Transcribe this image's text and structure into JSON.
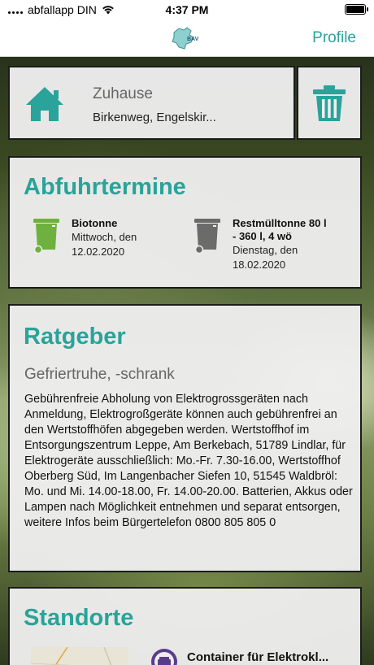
{
  "status_bar": {
    "carrier": "abfallapp DIN",
    "time": "4:37 PM"
  },
  "nav": {
    "logo_text": "BAV",
    "profile_label": "Profile"
  },
  "home": {
    "title": "Zuhause",
    "address": "Birkenweg, Engelskir..."
  },
  "abfuhrtermine": {
    "title": "Abfuhrtermine",
    "bins": [
      {
        "name": "Biotonne",
        "day": "Mittwoch, den",
        "date": "12.02.2020",
        "color": "#6fb13f",
        "icon": "green-bin-icon"
      },
      {
        "name_line1": "Restmülltonne 80 l",
        "name_line2": "- 360 l, 4 wö",
        "day": "Dienstag, den",
        "date": "18.02.2020",
        "color": "#6b6b6b",
        "icon": "gray-bin-icon"
      }
    ]
  },
  "ratgeber": {
    "title": "Ratgeber",
    "subtitle": "Gefriertruhe, -schrank",
    "text": "Gebührenfreie Abholung von Elektrogrossgeräten nach Anmeldung, Elektrogroßgeräte können auch gebührenfrei an den Wertstoffhöfen abgegeben werden. Wertstoffhof im Entsorgungszentrum Leppe, Am Berkebach, 51789 Lindlar, für Elektrogeräte ausschließlich: Mo.-Fr. 7.30-16.00, Wertstoffhof Oberberg Süd, Im Langenbacher Siefen 10, 51545 Waldbröl: Mo. und Mi. 14.00-18.00, Fr. 14.00-20.00. Batterien, Akkus oder Lampen nach Möglichkeit entnehmen und separat entsorgen, weitere Infos beim Bürgertelefon 0800 805 805 0"
  },
  "standorte": {
    "title": "Standorte",
    "first_location": "Container für Elektrokl..."
  },
  "colors": {
    "accent": "#2aa39a",
    "card_border": "#1b1b1b",
    "container_icon": "#5a3d8a"
  }
}
